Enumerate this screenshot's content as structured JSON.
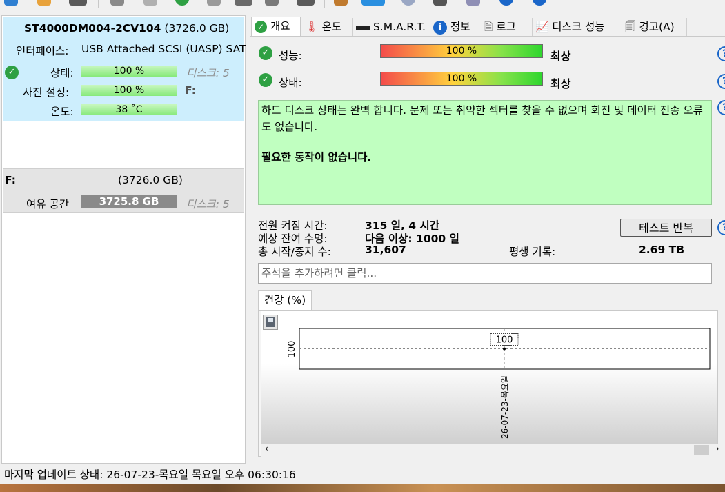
{
  "disk": {
    "model": "ST4000DM004-2CV104",
    "size": "(3726.0 GB)",
    "interface_label": "인터페이스:",
    "interface_value": "USB Attached SCSI (UASP) SAT",
    "state_label": "상태:",
    "state_value": "100 %",
    "preset_label": "사전 설정:",
    "preset_value": "100 %",
    "temp_label": "온도:",
    "temp_value": "38 ˚C",
    "disk_num": "디스크: 5",
    "drive_letter": "F:"
  },
  "volume": {
    "letter": "F:",
    "size": "(3726.0 GB)",
    "free_label": "여유 공간",
    "free_value": "3725.8 GB",
    "disk_num": "디스크: 5"
  },
  "tabs": [
    {
      "label": "개요",
      "icon": "check-icon"
    },
    {
      "label": "온도",
      "icon": "thermometer-icon"
    },
    {
      "label": "S.M.A.R.T.",
      "icon": "disk-icon"
    },
    {
      "label": "정보",
      "icon": "info-icon"
    },
    {
      "label": "로그",
      "icon": "document-icon"
    },
    {
      "label": "디스크 성능",
      "icon": "chart-icon"
    },
    {
      "label": "경고(A)",
      "icon": "copy-icon"
    }
  ],
  "overview": {
    "performance_label": "성능:",
    "performance_value": "100 %",
    "performance_rating": "최상",
    "state_label": "상태:",
    "state_value": "100 %",
    "state_rating": "최상",
    "status_text": "하드 디스크 상태는 완벽 합니다. 문제 또는 취약한 섹터를 찾을 수 없으며 회전 및 데이터 전송 오류도 없습니다.",
    "action_text": "필요한 동작이 없습니다.",
    "power_on_label": "전원 켜짐 시간:",
    "power_on_value": "315 일, 4 시간",
    "lifetime_label": "예상 잔여 수명:",
    "lifetime_value": "다음 이상: 1000 일",
    "starts_label": "총 시작/중지 수:",
    "starts_value": "31,607",
    "written_label": "평생 기록:",
    "written_value": "2.69 TB",
    "repeat_button": "테스트 반복",
    "comment_placeholder": "주석을 추가하려면 클릭..."
  },
  "graph": {
    "tab_label": "건강 (%)",
    "y_tick": "100",
    "point_label": "100",
    "x_label": "26-07-23-목요일"
  },
  "chart_data": {
    "type": "line",
    "x": [
      "26-07-23-목요일"
    ],
    "series": [
      {
        "values": [
          100
        ]
      }
    ],
    "xlabel": "",
    "ylabel": "",
    "grid": true
  },
  "statusbar": {
    "text": "마지막 업데이트 상태: 26-07-23-목요일 목요일 오후 06:30:16"
  },
  "colors": {
    "accent_blue": "#1a66c9",
    "ok_green": "#2ea043",
    "status_bg": "#c0ffc0",
    "disk_card_bg": "#cdeefd"
  }
}
